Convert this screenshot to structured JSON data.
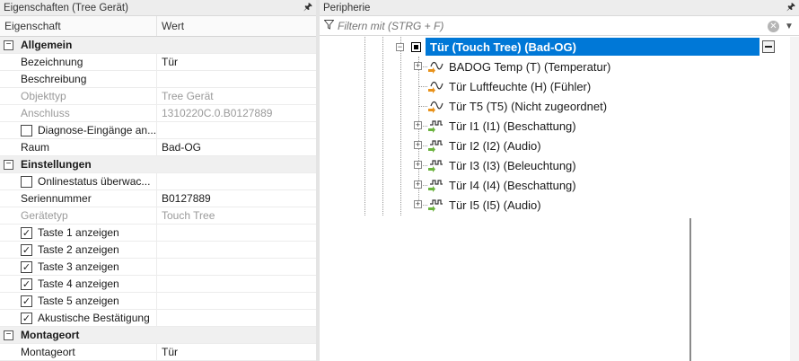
{
  "left_panel": {
    "title": "Eigenschaften (Tree Gerät)",
    "pin_icon": "pin-icon",
    "columns": {
      "name": "Eigenschaft",
      "value": "Wert"
    },
    "categories": {
      "allgemein": "Allgemein",
      "einstellungen": "Einstellungen",
      "montageort": "Montageort"
    },
    "rows": {
      "bezeichnung": {
        "name": "Bezeichnung",
        "value": "Tür"
      },
      "beschreibung": {
        "name": "Beschreibung",
        "value": ""
      },
      "objekttyp": {
        "name": "Objekttyp",
        "value": "Tree Gerät"
      },
      "anschluss": {
        "name": "Anschluss",
        "value": "1310220C.0.B0127889"
      },
      "diagnose": {
        "name": "Diagnose-Eingänge an...",
        "checked": false
      },
      "raum": {
        "name": "Raum",
        "value": "Bad-OG"
      },
      "onlinestatus": {
        "name": "Onlinestatus überwac...",
        "checked": false
      },
      "seriennummer": {
        "name": "Seriennummer",
        "value": "B0127889"
      },
      "geraetetyp": {
        "name": "Gerätetyp",
        "value": "Touch Tree"
      },
      "taste1": {
        "name": "Taste 1 anzeigen",
        "checked": true
      },
      "taste2": {
        "name": "Taste 2 anzeigen",
        "checked": true
      },
      "taste3": {
        "name": "Taste 3 anzeigen",
        "checked": true
      },
      "taste4": {
        "name": "Taste 4 anzeigen",
        "checked": true
      },
      "taste5": {
        "name": "Taste 5 anzeigen",
        "checked": true
      },
      "akustisch": {
        "name": "Akustische Bestätigung",
        "checked": true
      },
      "montageort": {
        "name": "Montageort",
        "value": "Tür"
      }
    },
    "check_glyph": "✓",
    "collapse_glyph": "−"
  },
  "right_panel": {
    "title": "Peripherie",
    "filter": {
      "placeholder": "Filtern mit (STRG + F)",
      "value": ""
    },
    "selected_node": "Tür (Touch Tree) (Bad-OG)",
    "nodes": [
      {
        "label": "BADOG Temp (T) (Temperatur)",
        "icon": "sensor-wave-icon",
        "expandable": true
      },
      {
        "label": "Tür Luftfeuchte (H) (Fühler)",
        "icon": "sensor-wave-icon",
        "expandable": false
      },
      {
        "label": "Tür T5 (T5) (Nicht zugeordnet)",
        "icon": "sensor-wave-icon",
        "expandable": false
      },
      {
        "label": "Tür I1 (I1) (Beschattung)",
        "icon": "input-pulse-icon",
        "expandable": true
      },
      {
        "label": "Tür I2 (I2) (Audio)",
        "icon": "input-pulse-icon",
        "expandable": true
      },
      {
        "label": "Tür I3 (I3) (Beleuchtung)",
        "icon": "input-pulse-icon",
        "expandable": true
      },
      {
        "label": "Tür I4 (I4) (Beschattung)",
        "icon": "input-pulse-icon",
        "expandable": true
      },
      {
        "label": "Tür I5 (I5) (Audio)",
        "icon": "input-pulse-icon",
        "expandable": true
      }
    ]
  },
  "colors": {
    "selection": "#0078d7",
    "arrow_orange": "#e8921b",
    "arrow_green": "#6cb33f"
  }
}
